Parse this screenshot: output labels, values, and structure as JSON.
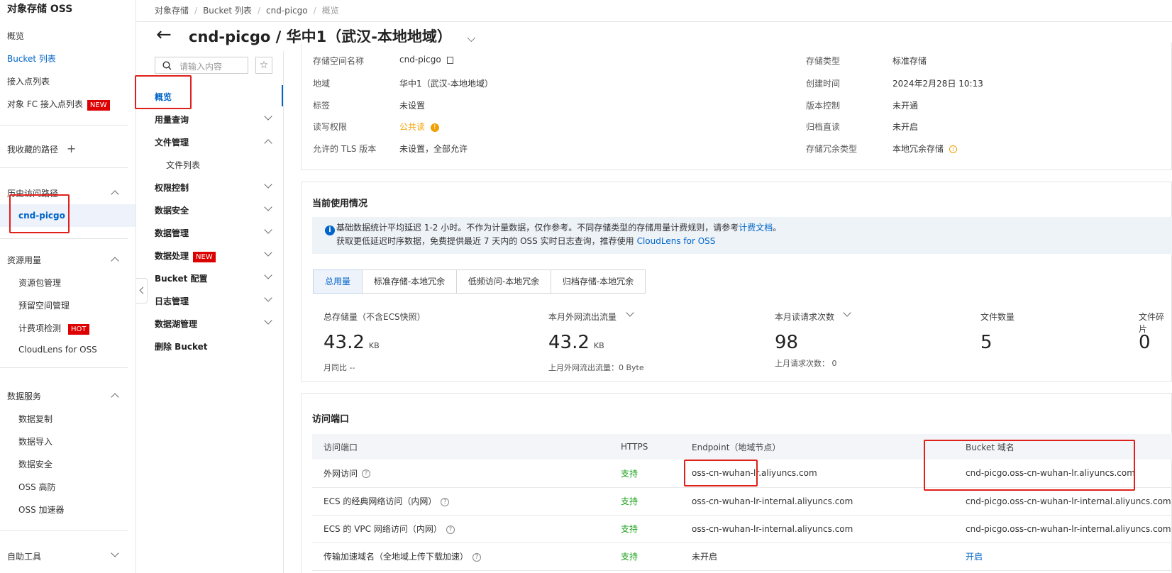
{
  "sidebar": {
    "title": "对象存储 OSS",
    "overview": "概览",
    "bucket_list": "Bucket 列表",
    "access_points": "接入点列表",
    "fc_access_points": "对象 FC 接入点列表",
    "fc_badge": "NEW",
    "favorites": "我收藏的路径",
    "favorites_add": "+",
    "history": "历史访问路径",
    "history_item": "cnd-picgo",
    "resources": "资源用量",
    "resource_items": [
      "资源包管理",
      "预留空间管理",
      "计费项检测",
      "CloudLens for OSS"
    ],
    "hot_badge": "HOT",
    "data_services": "数据服务",
    "data_items": [
      "数据复制",
      "数据导入",
      "数据安全",
      "OSS 高防",
      "OSS 加速器"
    ],
    "tools": "自助工具"
  },
  "breadcrumb": [
    "对象存储",
    "Bucket 列表",
    "cnd-picgo",
    "概览"
  ],
  "header": {
    "back": "←",
    "title": "cnd-picgo / 华中1（武汉-本地地域）",
    "dropdown": "⌵"
  },
  "subnav": {
    "search_placeholder": "请输入内容",
    "items": [
      "概览",
      "用量查询",
      "文件管理",
      "文件列表",
      "权限控制",
      "数据安全",
      "数据管理",
      "数据处理",
      "Bucket 配置",
      "日志管理",
      "数据湖管理",
      "删除 Bucket"
    ],
    "new_badge": "NEW"
  },
  "basic_info": {
    "left": [
      {
        "label": "存储空间名称",
        "value": "cnd-picgo"
      },
      {
        "label": "地域",
        "value": "华中1（武汉-本地地域）"
      },
      {
        "label": "标签",
        "value": "未设置"
      },
      {
        "label": "读写权限",
        "value": "公共读"
      },
      {
        "label": "允许的 TLS 版本",
        "value": "未设置，全部允许"
      }
    ],
    "right": [
      {
        "label": "存储类型",
        "value": "标准存储"
      },
      {
        "label": "创建时间",
        "value": "2024年2月28日 10:13"
      },
      {
        "label": "版本控制",
        "value": "未开通"
      },
      {
        "label": "归档直读",
        "value": "未开启"
      },
      {
        "label": "存储冗余类型",
        "value": "本地冗余存储"
      }
    ]
  },
  "usage": {
    "title": "当前使用情况",
    "notice_line1_pre": "基础数据统计平均延迟 1-2 小时。不作为计量数据，仅作参考。不同存储类型的存储用量计费规则，请参考",
    "notice_line1_link": "计费文档",
    "notice_line1_post": "。",
    "notice_line2_pre": "获取更低延迟时序数据，免费提供最近 7 天内的 OSS 实时日志查询，推荐使用",
    "notice_line2_link": "CloudLens for OSS",
    "tabs": [
      "总用量",
      "标准存储-本地冗余",
      "低频访问-本地冗余",
      "归档存储-本地冗余"
    ],
    "stats": [
      {
        "label": "总存储量（不含ECS快照）",
        "value": "43.2",
        "unit": "KB",
        "sub": "月同比 --"
      },
      {
        "label": "本月外网流出流量",
        "value": "43.2",
        "unit": "KB",
        "sub": "上月外网流出流量：0 Byte"
      },
      {
        "label": "本月读请求次数",
        "value": "98",
        "unit": "",
        "sub": "上月请求次数：  0"
      },
      {
        "label": "文件数量",
        "value": "5",
        "unit": "",
        "sub": ""
      },
      {
        "label": "文件碎片",
        "value": "0",
        "unit": "",
        "sub": ""
      }
    ]
  },
  "endpoints": {
    "title": "访问端口",
    "headers": [
      "访问端口",
      "HTTPS",
      "Endpoint（地域节点）",
      "Bucket 域名"
    ],
    "rows": [
      [
        "外网访问",
        "支持",
        "oss-cn-wuhan-lr.aliyuncs.com",
        "cnd-picgo.oss-cn-wuhan-lr.aliyuncs.com"
      ],
      [
        "ECS 的经典网络访问（内网）",
        "支持",
        "oss-cn-wuhan-lr-internal.aliyuncs.com",
        "cnd-picgo.oss-cn-wuhan-lr-internal.aliyuncs.com"
      ],
      [
        "ECS 的 VPC 网络访问（内网）",
        "支持",
        "oss-cn-wuhan-lr-internal.aliyuncs.com",
        "cnd-picgo.oss-cn-wuhan-lr-internal.aliyuncs.com"
      ],
      [
        "传输加速域名（全地域上传下载加速）",
        "支持",
        "未开启",
        "开启"
      ]
    ]
  },
  "colors": {
    "accent": "#0064c8",
    "highlight": "#e0201a",
    "success": "#1aa01a",
    "warning": "#f0a000"
  }
}
